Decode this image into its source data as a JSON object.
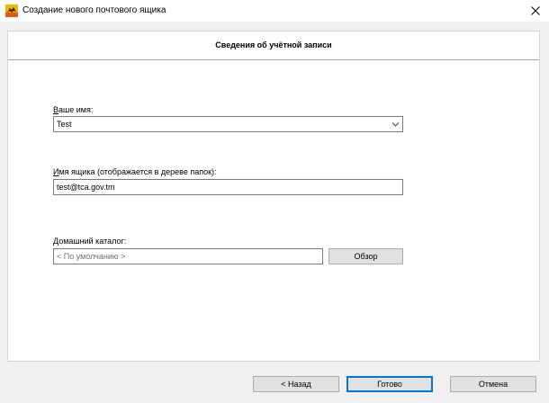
{
  "window": {
    "title": "Создание нового почтового ящика",
    "app_icon": "bat-mail-icon",
    "close_icon": "close-icon"
  },
  "header": {
    "title": "Сведения об учётной записи"
  },
  "fields": {
    "name": {
      "label_accel": "В",
      "label_rest": "аше имя:",
      "value": "Test",
      "arrow_icon": "chevron-down-icon"
    },
    "mailbox": {
      "label_accel": "И",
      "label_rest": "мя ящика (отображается в дереве папок):",
      "value": "test@tca.gov.tm"
    },
    "home_dir": {
      "label_accel": "Д",
      "label_rest": "омашний каталог:",
      "placeholder": "< По умолчанию >",
      "browse_label": "Обзор"
    }
  },
  "footer": {
    "back_label": "< Назад",
    "finish_label": "Готово",
    "cancel_label": "Отмена"
  },
  "colors": {
    "window_bg": "#f0f0f0",
    "panel_bg": "#ffffff",
    "input_border": "#7a7a7a",
    "default_button_border": "#0078d7",
    "button_bg": "#e1e1e1"
  }
}
